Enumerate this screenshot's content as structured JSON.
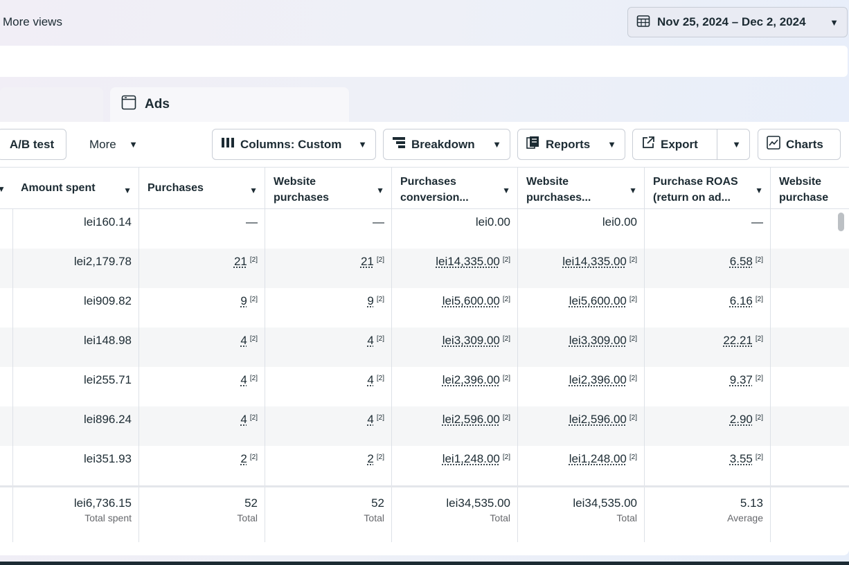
{
  "header": {
    "more_views": "More views",
    "date_range": "Nov 25, 2024 – Dec 2, 2024"
  },
  "tabs": {
    "ads": "Ads"
  },
  "toolbar": {
    "ab_test": "A/B test",
    "more": "More",
    "columns": "Columns: Custom",
    "breakdown": "Breakdown",
    "reports": "Reports",
    "export": "Export",
    "charts": "Charts"
  },
  "table": {
    "columns": [
      {
        "label": "Amount spent"
      },
      {
        "label": "Purchases"
      },
      {
        "label": "Website purchases"
      },
      {
        "label": "Purchases conversion..."
      },
      {
        "label": "Website purchases..."
      },
      {
        "label": "Purchase ROAS (return on ad..."
      },
      {
        "label": "Website purchase RO"
      }
    ],
    "footnote": "[2]",
    "rows": [
      {
        "amount_spent": "lei160.14",
        "purchases": "—",
        "website_purchases": "—",
        "purchases_conversion": "lei0.00",
        "website_purchases_value": "lei0.00",
        "roas": "—"
      },
      {
        "amount_spent": "lei2,179.78",
        "purchases": "21",
        "website_purchases": "21",
        "purchases_conversion": "lei14,335.00",
        "website_purchases_value": "lei14,335.00",
        "roas": "6.58"
      },
      {
        "amount_spent": "lei909.82",
        "purchases": "9",
        "website_purchases": "9",
        "purchases_conversion": "lei5,600.00",
        "website_purchases_value": "lei5,600.00",
        "roas": "6.16"
      },
      {
        "amount_spent": "lei148.98",
        "purchases": "4",
        "website_purchases": "4",
        "purchases_conversion": "lei3,309.00",
        "website_purchases_value": "lei3,309.00",
        "roas": "22.21"
      },
      {
        "amount_spent": "lei255.71",
        "purchases": "4",
        "website_purchases": "4",
        "purchases_conversion": "lei2,396.00",
        "website_purchases_value": "lei2,396.00",
        "roas": "9.37"
      },
      {
        "amount_spent": "lei896.24",
        "purchases": "4",
        "website_purchases": "4",
        "purchases_conversion": "lei2,596.00",
        "website_purchases_value": "lei2,596.00",
        "roas": "2.90"
      },
      {
        "amount_spent": "lei351.93",
        "purchases": "2",
        "website_purchases": "2",
        "purchases_conversion": "lei1,248.00",
        "website_purchases_value": "lei1,248.00",
        "roas": "3.55"
      }
    ],
    "totals": {
      "amount_spent": {
        "value": "lei6,736.15",
        "label": "Total spent"
      },
      "purchases": {
        "value": "52",
        "label": "Total"
      },
      "website_purchases": {
        "value": "52",
        "label": "Total"
      },
      "purchases_conversion": {
        "value": "lei34,535.00",
        "label": "Total"
      },
      "website_purchases_value": {
        "value": "lei34,535.00",
        "label": "Total"
      },
      "roas": {
        "value": "5.13",
        "label": "Average"
      }
    }
  }
}
